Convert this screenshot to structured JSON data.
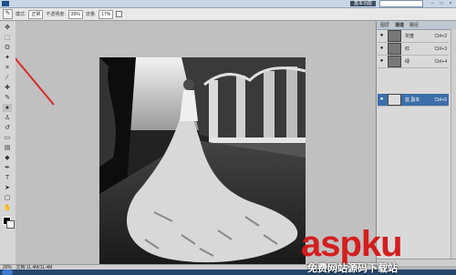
{
  "menubar": {
    "workspace": "基本功能",
    "window_controls": [
      "–",
      "□",
      "×"
    ]
  },
  "options": {
    "mode_label": "模式:",
    "mode_value": "正常",
    "opacity_label": "不透明度:",
    "opacity_value": "30%",
    "flow_label": "流量:",
    "flow_value": "17%"
  },
  "channels": [
    {
      "name": "灰度",
      "key": "Ctrl+2",
      "active": false
    },
    {
      "name": "红",
      "key": "Ctrl+3",
      "active": false
    },
    {
      "name": "绿",
      "key": "Ctrl+4",
      "active": false
    },
    {
      "name": "蓝 副本",
      "key": "Ctrl+6",
      "active": true
    }
  ],
  "panel_tabs": [
    "图层",
    "通道",
    "路径"
  ],
  "status": {
    "zoom": "20%",
    "doc": "文档:11.4M/11.4M"
  },
  "watermark": {
    "big": "aspku",
    "small": "免费网站源码下载站"
  },
  "colors": {
    "foreground": "#000000",
    "background": "#ffffff",
    "active_channel": "#3c6ea8",
    "annotation": "#d62b2b"
  },
  "icons": [
    "move-icon",
    "marquee-icon",
    "lasso-icon",
    "brush-icon",
    "eye-icon"
  ]
}
